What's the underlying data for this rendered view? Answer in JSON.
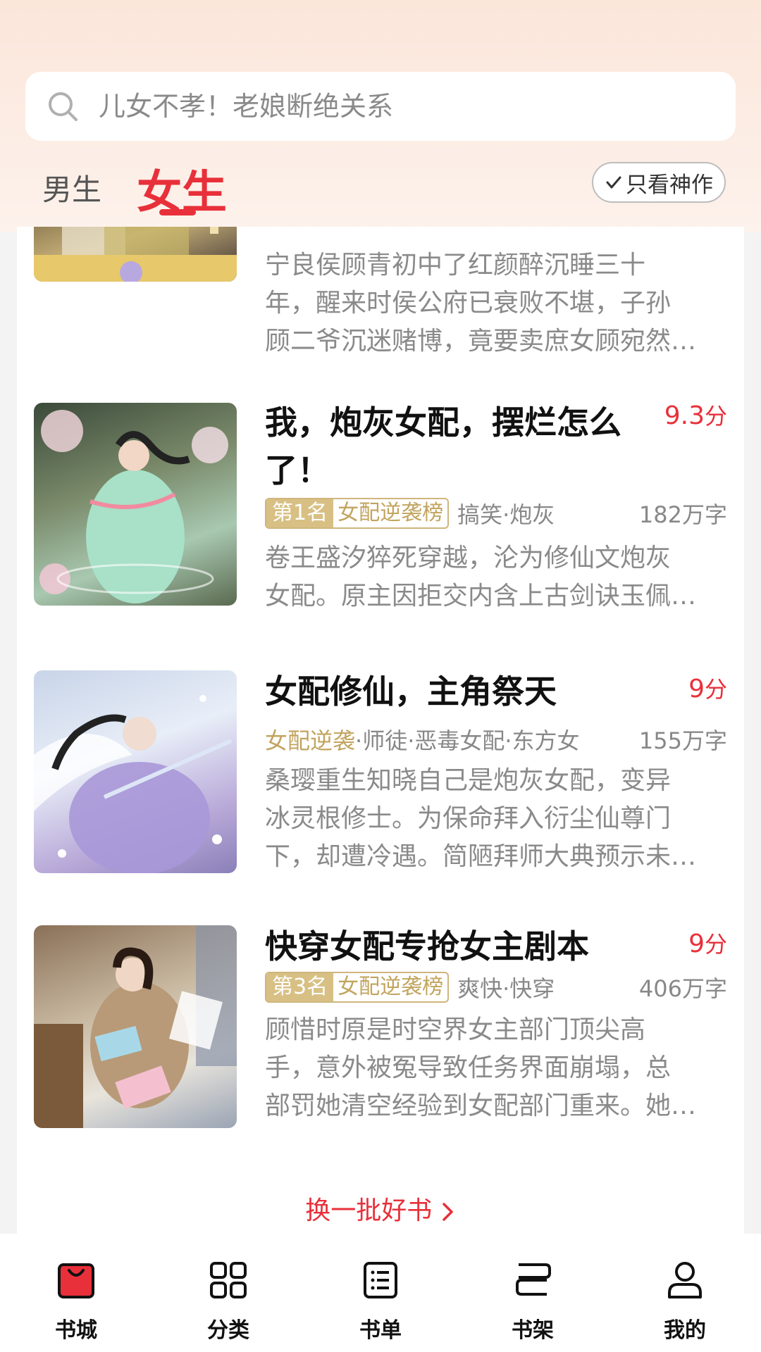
{
  "search": {
    "placeholder_text": "儿女不孝！老娘断绝关系"
  },
  "tabs": {
    "male": "男生",
    "female": "女生"
  },
  "filter": {
    "label": "只看神作"
  },
  "books": [
    {
      "title": "",
      "desc_lines": [
        "宁良侯顾青初中了红颜醉沉睡三十",
        "年，醒来时侯公府已衰败不堪，子孙",
        "顾二爷沉迷赌博，竟要卖庶女顾宛然…"
      ]
    },
    {
      "title_line1": "我，炮灰女配，摆烂怎么",
      "title_line2": "了！",
      "score": "9.3",
      "score_unit": "分",
      "rank": "第1名",
      "rank_list": "女配逆袭榜",
      "tags": "搞笑·炮灰",
      "words": "182万字",
      "desc_lines": [
        "卷王盛汐猝死穿越，沦为修仙文炮灰",
        "女配。原主因拒交内含上古剑诀玉佩…"
      ]
    },
    {
      "title": "女配修仙，主角祭天",
      "score": "9",
      "score_unit": "分",
      "tag_gold": "女配逆袭",
      "tags": "·师徒·恶毒女配·东方女",
      "words": "155万字",
      "desc_lines": [
        "桑璎重生知晓自己是炮灰女配，变异",
        "冰灵根修士。为保命拜入衍尘仙尊门",
        "下，却遭冷遇。简陋拜师大典预示未…"
      ]
    },
    {
      "title": "快穿女配专抢女主剧本",
      "score": "9",
      "score_unit": "分",
      "rank": "第3名",
      "rank_list": "女配逆袭榜",
      "tags": "爽快·快穿",
      "words": "406万字",
      "desc_lines": [
        "顾惜时原是时空界女主部门顶尖高",
        "手，意外被冤导致任务界面崩塌，总",
        "部罚她清空经验到女配部门重来。她…"
      ]
    }
  ],
  "refresh": {
    "label": "换一批好书"
  },
  "nav": [
    {
      "label": "书城",
      "icon": "bookstore-icon"
    },
    {
      "label": "分类",
      "icon": "grid-icon"
    },
    {
      "label": "书单",
      "icon": "list-icon"
    },
    {
      "label": "书架",
      "icon": "bookshelf-icon"
    },
    {
      "label": "我的",
      "icon": "profile-icon"
    }
  ],
  "colors": {
    "accent": "#e8303a",
    "gold": "#c2a45e"
  }
}
